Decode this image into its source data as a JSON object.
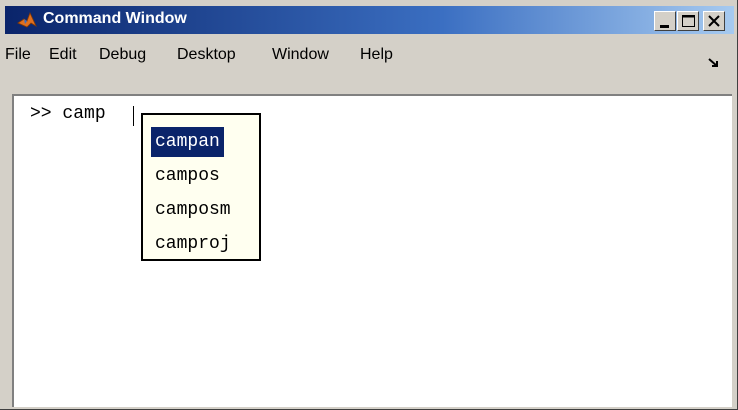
{
  "window": {
    "title": "Command Window",
    "controls": [
      "minimize-icon",
      "maximize-icon",
      "close-icon"
    ]
  },
  "menu": [
    "File",
    "Edit",
    "Debug",
    "Desktop",
    "Window",
    "Help"
  ],
  "console": {
    "prompt": ">>",
    "input": "camp"
  },
  "autocomplete": {
    "items": [
      "campan",
      "campos",
      "camposm",
      "camproj"
    ],
    "selected": "campan"
  },
  "colors": {
    "title_gradient_start": "#0a246a",
    "title_gradient_end": "#a6caf0",
    "selection": "#0a246a",
    "window_chrome": "#d4d0c8"
  }
}
